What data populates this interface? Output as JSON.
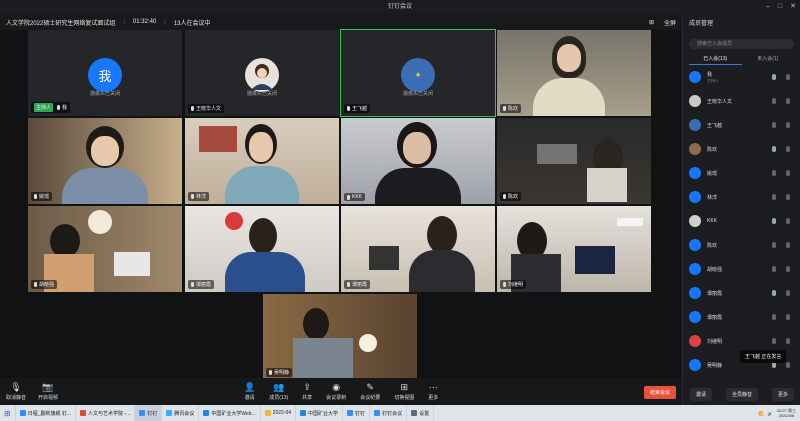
{
  "window": {
    "title": "钉钉会议",
    "controls": [
      "–",
      "□",
      "✕"
    ]
  },
  "info_bar": {
    "meeting_title": "人文学院2022硕士研究生网络复试面试组",
    "timer": "01:32:40",
    "attendance": "13人在会议中",
    "fullscreen_label": "全屏"
  },
  "tiles": [
    {
      "name": "我",
      "host_badge": "主持人",
      "nametag": "我",
      "camera_off_text": "摄像头已关闭",
      "avatar_color": "#1677ff",
      "avatar_text": "我"
    },
    {
      "name": "王晓华人文",
      "nametag": "王晓华人文",
      "camera_off_text": "摄像头已关闭"
    },
    {
      "name": "王飞越",
      "nametag": "王飞越",
      "camera_off_text": "摄像头已关闭",
      "avatar_color": "#3a6fb5"
    },
    {
      "name": "陈欢",
      "nametag": "陈欢"
    },
    {
      "name": "姚璟",
      "nametag": "姚璟"
    },
    {
      "name": "林洋",
      "nametag": "林洋"
    },
    {
      "name": "KKK",
      "nametag": "KKK"
    },
    {
      "name": "陈欢2",
      "nametag": "陈欢"
    },
    {
      "name": "胡晓强",
      "nametag": "胡晓强"
    },
    {
      "name": "谭丽霞",
      "nametag": "谭丽霞"
    },
    {
      "name": "谭丽霞2",
      "nametag": "谭丽霞"
    },
    {
      "name": "刘继明",
      "nametag": "刘继明"
    },
    {
      "name": "吴明静",
      "nametag": "吴明静"
    }
  ],
  "sidebar": {
    "title": "成员管理",
    "search_placeholder": "搜索已入会成员",
    "tabs": [
      "已入会(13)",
      "未入会(1)"
    ],
    "members": [
      {
        "name": "我",
        "sub": "主持人",
        "color": "#1677ff"
      },
      {
        "name": "王晓华人文",
        "color": "#c9c9c9"
      },
      {
        "name": "王飞越",
        "color": "#3a6fb5"
      },
      {
        "name": "陈欢",
        "color": "#8a6b4e"
      },
      {
        "name": "姚璟",
        "color": "#1677ff"
      },
      {
        "name": "林洋",
        "color": "#1677ff"
      },
      {
        "name": "KKK",
        "color": "#cfcfcf"
      },
      {
        "name": "陈欢",
        "color": "#1677ff"
      },
      {
        "name": "胡晓强",
        "color": "#1677ff"
      },
      {
        "name": "谭丽霞",
        "color": "#1677ff"
      },
      {
        "name": "谭丽霞",
        "color": "#1677ff"
      },
      {
        "name": "刘继明",
        "color": "#d64545"
      },
      {
        "name": "吴明静",
        "color": "#1677ff"
      }
    ],
    "bottom_buttons": [
      "邀请",
      "全员静音",
      "更多"
    ]
  },
  "speaking": "王飞越 正在发言",
  "toolbar": {
    "left": [
      {
        "icon": "mic-icon",
        "label": "取消静音"
      },
      {
        "icon": "camera-icon",
        "label": "开启视频"
      }
    ],
    "mid": [
      {
        "icon": "invite-icon",
        "label": "邀请"
      },
      {
        "icon": "members-icon",
        "label": "成员(13)"
      },
      {
        "icon": "share-icon",
        "label": "共享"
      },
      {
        "icon": "record-icon",
        "label": "会议录制"
      },
      {
        "icon": "chat-icon",
        "label": "会议纪要"
      },
      {
        "icon": "layout-icon",
        "label": "切换视图"
      },
      {
        "icon": "more-icon",
        "label": "更多"
      }
    ],
    "leave_label": "结束会议"
  },
  "taskbar": {
    "items": [
      {
        "label": "日程_翻新旗舰 钉...",
        "color": "#2f8cff"
      },
      {
        "label": "人文与艺术学院 -...",
        "color": "#e04a3c"
      },
      {
        "label": "钉钉",
        "color": "#3a8df5",
        "selected": true
      },
      {
        "label": "腾讯会议",
        "color": "#2fb1ff"
      },
      {
        "label": "中国矿业大学Web...",
        "color": "#1e88e5"
      },
      {
        "label": "2022-04",
        "color": "#e8b83a"
      },
      {
        "label": "中国矿业大学",
        "color": "#1e88e5"
      },
      {
        "label": "钉钉",
        "color": "#3a8df5"
      },
      {
        "label": "钉钉会议",
        "color": "#3a8df5"
      },
      {
        "label": "设置",
        "color": "#5b6b80"
      }
    ],
    "time": "20:27 周三",
    "date": "2022/4/6"
  }
}
